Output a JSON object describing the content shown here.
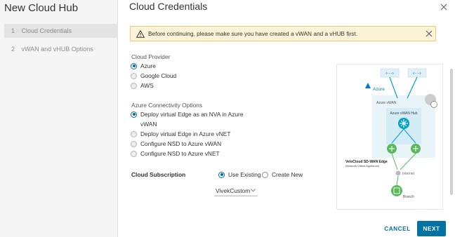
{
  "wizard": {
    "title": "New Cloud Hub",
    "steps": [
      {
        "num": "1",
        "label": "Cloud Credentials",
        "active": true
      },
      {
        "num": "2",
        "label": "vWAN and vHUB Options",
        "active": false
      }
    ]
  },
  "header": {
    "title": "Cloud Credentials"
  },
  "alert": {
    "message": "Before continuing, please make sure you have created a vWAN and a vHUB first."
  },
  "provider": {
    "label": "Cloud Provider",
    "options": [
      "Azure",
      "Google Cloud",
      "AWS"
    ],
    "selected": "Azure"
  },
  "connectivity": {
    "label": "Azure Connectivity Options",
    "options": [
      {
        "line1": "Deploy virtual Edge as an NVA in Azure",
        "line2": "vWAN"
      },
      {
        "line1": "Deploy virtual Edge in Azure vNET"
      },
      {
        "line1": "Configure NSD to Azure vWAN"
      },
      {
        "line1": "Configure NSD to Azure vNET"
      }
    ],
    "selected": 0
  },
  "subscription": {
    "label": "Cloud Subscription",
    "use_existing": "Use Existing",
    "create_new": "Create New",
    "selected_value": "VivekCustom"
  },
  "diagram": {
    "azure_label": "Azure",
    "vwan_label": "Azure vWAN",
    "hub_label": "Azure vWAN Hub",
    "edge_title": "VeloCloud SD-WAN Edge",
    "edge_sub": "(Network Virtual Appliance)",
    "internet_label": "Internet",
    "branch_label": "Branch",
    "node_symbol": "‹···›"
  },
  "footer": {
    "cancel": "CANCEL",
    "next": "NEXT"
  },
  "colors": {
    "accent": "#0072a3",
    "alert_bg": "#fdf4d8",
    "diagram_cyan": "#00a1c9",
    "edge_green": "#5cb85c"
  }
}
